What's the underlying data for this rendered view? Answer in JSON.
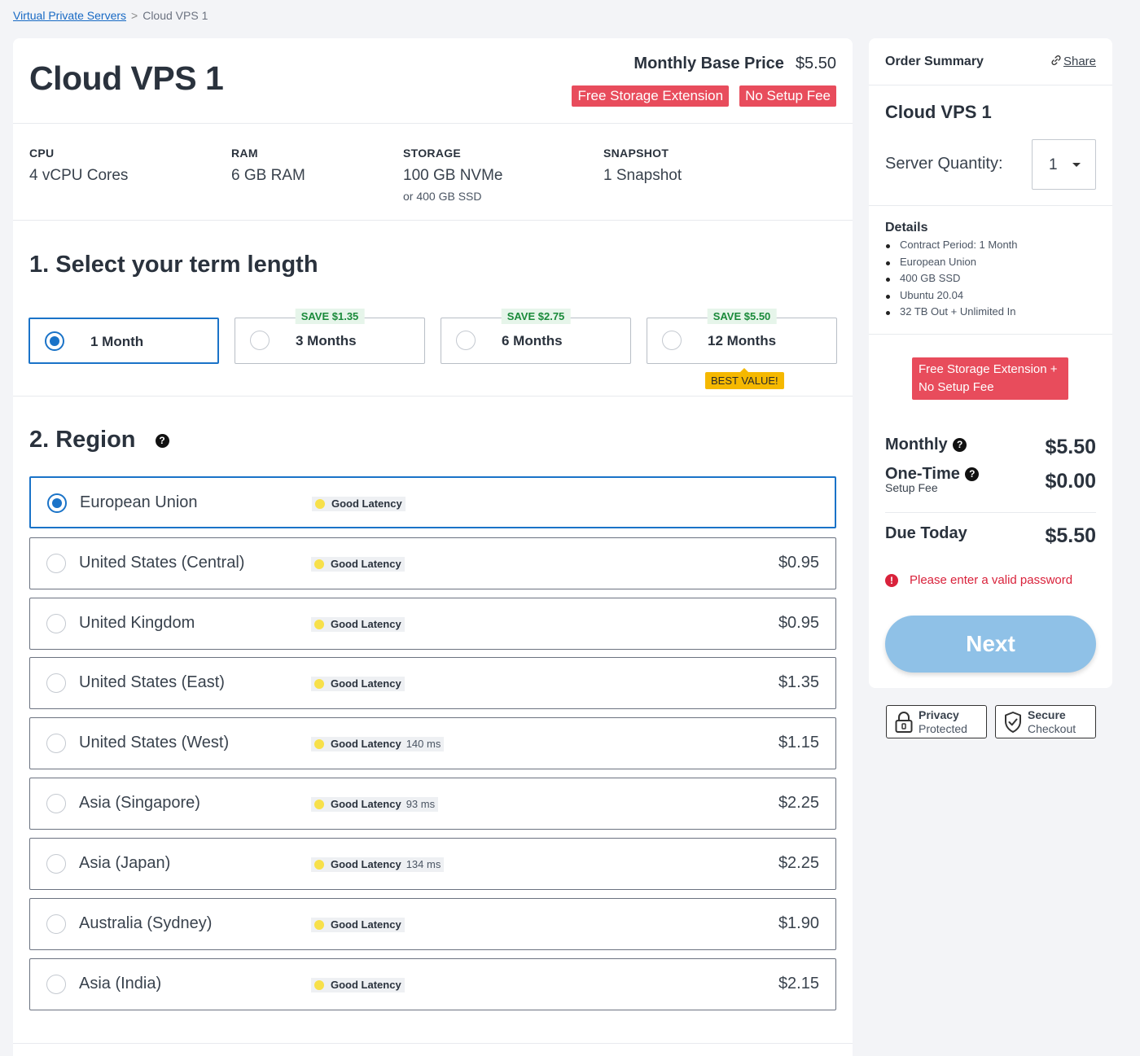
{
  "breadcrumb": {
    "parent": "Virtual Private Servers",
    "separator": ">",
    "current": "Cloud VPS 1"
  },
  "product": {
    "title": "Cloud VPS 1",
    "base_price_label": "Monthly Base Price",
    "base_price": "$5.50",
    "tags": [
      "Free Storage Extension",
      "No Setup Fee"
    ]
  },
  "specs": [
    {
      "key": "CPU",
      "value": "4 vCPU Cores",
      "sub": ""
    },
    {
      "key": "RAM",
      "value": "6 GB RAM",
      "sub": ""
    },
    {
      "key": "STORAGE",
      "value": "100 GB NVMe",
      "sub": "or 400 GB SSD"
    },
    {
      "key": "SNAPSHOT",
      "value": "1 Snapshot",
      "sub": ""
    }
  ],
  "term": {
    "title": "1. Select your term length",
    "options": [
      {
        "label": "1 Month",
        "save": "",
        "selected": true
      },
      {
        "label": "3 Months",
        "save": "SAVE $1.35",
        "selected": false
      },
      {
        "label": "6 Months",
        "save": "SAVE $2.75",
        "selected": false
      },
      {
        "label": "12 Months",
        "save": "SAVE $5.50",
        "selected": false,
        "badge": "BEST VALUE!"
      }
    ]
  },
  "region": {
    "title": "2. Region",
    "help": "?",
    "options": [
      {
        "name": "European Union",
        "latency": "Good Latency",
        "ms": "",
        "price": "",
        "selected": true
      },
      {
        "name": "United States (Central)",
        "latency": "Good Latency",
        "ms": "",
        "price": "$0.95"
      },
      {
        "name": "United Kingdom",
        "latency": "Good Latency",
        "ms": "",
        "price": "$0.95"
      },
      {
        "name": "United States (East)",
        "latency": "Good Latency",
        "ms": "",
        "price": "$1.35"
      },
      {
        "name": "United States (West)",
        "latency": "Good Latency",
        "ms": "140 ms",
        "price": "$1.15"
      },
      {
        "name": "Asia (Singapore)",
        "latency": "Good Latency",
        "ms": "93 ms",
        "price": "$2.25"
      },
      {
        "name": "Asia (Japan)",
        "latency": "Good Latency",
        "ms": "134 ms",
        "price": "$2.25"
      },
      {
        "name": "Australia (Sydney)",
        "latency": "Good Latency",
        "ms": "",
        "price": "$1.90"
      },
      {
        "name": "Asia (India)",
        "latency": "Good Latency",
        "ms": "",
        "price": "$2.15"
      }
    ]
  },
  "summary": {
    "title": "Order Summary",
    "share": "Share",
    "product": "Cloud VPS 1",
    "quantity_label": "Server Quantity:",
    "quantity": "1",
    "details_title": "Details",
    "details": [
      "Contract Period: 1 Month",
      "European Union",
      "400 GB SSD",
      "Ubuntu 20.04",
      "32 TB Out + Unlimited In"
    ],
    "promo": "Free Storage Extension + No Setup Fee",
    "monthly_label": "Monthly",
    "monthly": "$5.50",
    "onetime_label": "One-Time",
    "onetime_sub": "Setup Fee",
    "onetime": "$0.00",
    "due_label": "Due Today",
    "due": "$5.50",
    "error": "Please enter a valid password",
    "next": "Next"
  },
  "trust": [
    {
      "title": "Privacy",
      "sub": "Protected",
      "icon": "lock-icon"
    },
    {
      "title": "Secure",
      "sub": "Checkout",
      "icon": "shield-check-icon"
    }
  ],
  "colors": {
    "accent": "#1a73c8",
    "promo": "#e84c5c",
    "save": "#1a8a3a",
    "best": "#f5b800",
    "error": "#d9223b",
    "next": "#8fc1e7"
  }
}
